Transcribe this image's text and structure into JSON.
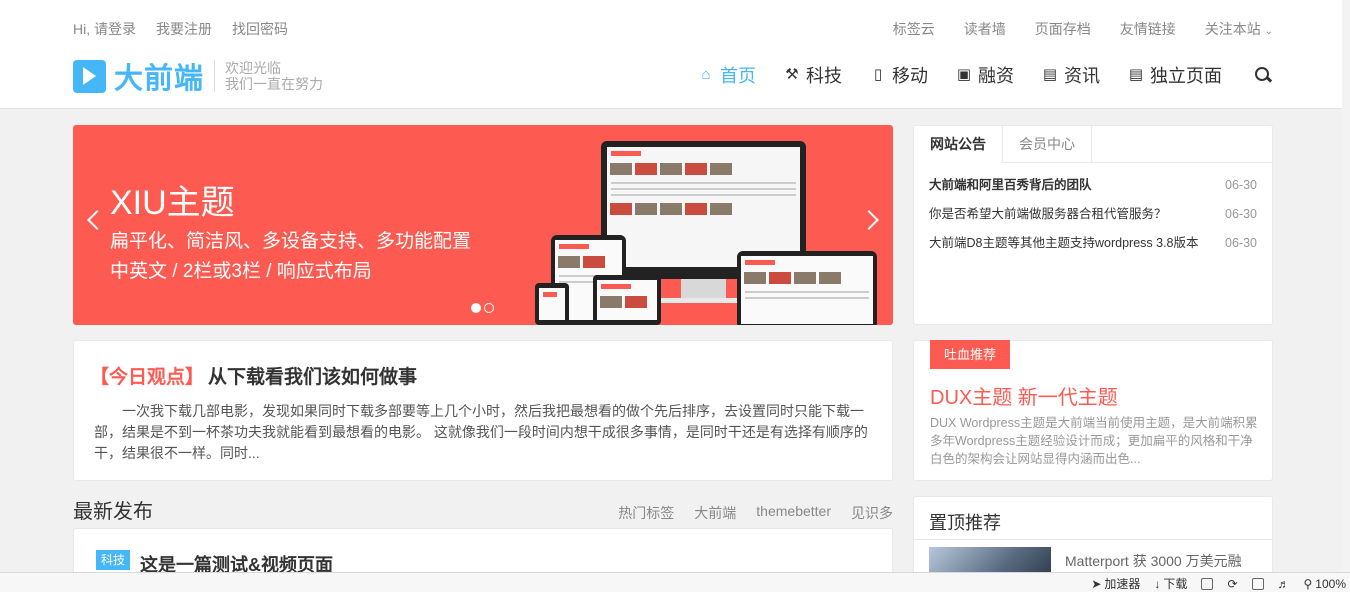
{
  "topbar": {
    "left": [
      "Hi, 请登录",
      "我要注册",
      "找回密码"
    ],
    "right": [
      "标签云",
      "读者墙",
      "页面存档",
      "友情链接",
      "关注本站"
    ]
  },
  "logo": {
    "name": "大前端",
    "slogan1": "欢迎光临",
    "slogan2": "我们一直在努力"
  },
  "nav": [
    {
      "label": "首页",
      "icon": "home-icon"
    },
    {
      "label": "科技",
      "icon": "wrench-icon"
    },
    {
      "label": "移动",
      "icon": "mobile-icon"
    },
    {
      "label": "融资",
      "icon": "money-icon"
    },
    {
      "label": "资讯",
      "icon": "book-icon"
    },
    {
      "label": "独立页面",
      "icon": "file-icon"
    }
  ],
  "banner": {
    "title": "XIU主题",
    "sub1": "扁平化、简洁风、多设备支持、多功能配置",
    "sub2": "中英文 / 2栏或3栏 / 响应式布局",
    "slide_index": 1,
    "slide_count": 2
  },
  "notice": {
    "tabs": [
      "网站公告",
      "会员中心"
    ],
    "items": [
      {
        "title": "大前端和阿里百秀背后的团队",
        "date": "06-30"
      },
      {
        "title": "你是否希望大前端做服务器合租代管服务？",
        "date": "06-30"
      },
      {
        "title": "大前端D8主题等其他主题支持wordpress 3.8版本",
        "date": "06-30"
      }
    ]
  },
  "today": {
    "tag": "【今日观点】",
    "title": "从下载看我们该如何做事",
    "body": "一次我下载几部电影，发现如果同时下载多部要等上几个小时，然后我把最想看的做个先后排序，去设置同时只能下载一部，结果是不到一杯茶功夫我就能看到最想看的电影。 这就像我们一段时间内想干成很多事情，是同时干还是有选择有顺序的干，结果很不一样。同时..."
  },
  "recommend": {
    "badge": "吐血推荐",
    "title": "DUX主题 新一代主题",
    "body": "DUX Wordpress主题是大前端当前使用主题，是大前端积累多年Wordpress主题经验设计而成；更加扁平的风格和干净白色的架构会让网站显得内涵而出色..."
  },
  "latest": {
    "heading": "最新发布",
    "tags": [
      "热门标签",
      "大前端",
      "themebetter",
      "见识多"
    ],
    "post": {
      "category": "科技",
      "title": "这是一篇测试&视频页面"
    }
  },
  "pinned": {
    "heading": "置顶推荐",
    "item_title": "Matterport 获 3000 万美元融"
  },
  "statusbar": {
    "accelerator": "加速器",
    "download": "下载",
    "zoom": "100%"
  },
  "colors": {
    "accent": "#45b6f7",
    "banner": "#fd5b52",
    "background": "#f1f1f1"
  }
}
